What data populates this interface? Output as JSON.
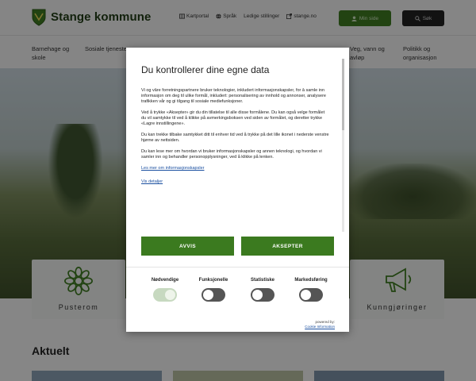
{
  "header": {
    "brand": "Stange kommune",
    "links": [
      {
        "label": "Kartportal",
        "icon": "map-icon"
      },
      {
        "label": "Språk",
        "icon": "globe-icon"
      },
      {
        "label": "Ledige stillinger",
        "icon": ""
      },
      {
        "label": "stange.no",
        "icon": "external-icon"
      }
    ],
    "mine_side_label": "Min side",
    "search_label": "Søk"
  },
  "nav": {
    "items": [
      "Barnehage og skole",
      "Sosiale tjenester",
      "Veg, vann og avløp",
      "Politikk og organisasjon"
    ]
  },
  "tiles": {
    "left_label": "Pusterom",
    "right_label": "Kunngjøringer"
  },
  "section": {
    "aktuelt": "Aktuelt"
  },
  "modal": {
    "title": "Du kontrollerer dine egne data",
    "paragraphs": [
      "Vi og våre forretningspartnere bruker teknologier, inkludert informasjonskapsler, for å samle inn informasjon om deg til ulike formål, inkludert: personalisering av innhold og annonser, analysere trafikken vår og gi tilgang til sosiale mediefunksjoner.",
      "Ved å trykke «Aksepter» gir du din tillatelse til alle disse formålene. Du kan også velge formålet du vil samtykke til ved å klikke på avmerkingsboksen ved siden av formålet, og deretter trykke «Lagre innstillingene».",
      "Du kan trekke tilbake samtykket ditt til enhver tid ved å trykke på det lille ikonet i nederste venstre hjørne av nettsiden.",
      "Du kan lese mer om hvordan vi bruker informasjonskapsler og annen teknologi, og hvordan vi samler inn og behandler personopplysninger, ved å klikke på lenken."
    ],
    "link_read_more": "Les mer om informasjonskapsler",
    "link_details": "Vis detaljer",
    "reject_label": "AVVIS",
    "accept_label": "AKSEPTER",
    "toggles": [
      {
        "label": "Nødvendige",
        "on": true
      },
      {
        "label": "Funksjonelle",
        "on": false
      },
      {
        "label": "Statistiske",
        "on": false
      },
      {
        "label": "Markedsføring",
        "on": false
      }
    ],
    "powered_by": "powered by:",
    "powered_link": "Cookie Information"
  },
  "colors": {
    "brand_green": "#3b7a1f",
    "link_blue": "#1a4fa0",
    "dark_button": "#222222"
  }
}
